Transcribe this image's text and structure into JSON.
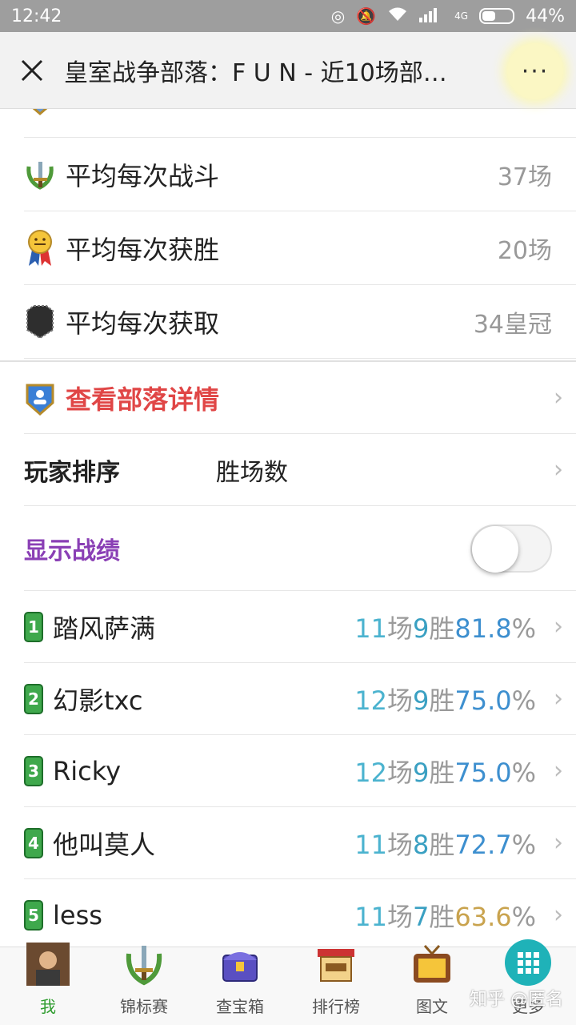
{
  "status_bar": {
    "time": "12:42",
    "battery": "44%",
    "battery_level": 0.44,
    "network": "4G"
  },
  "header": {
    "title": "皇室战争部落：F U N - 近10场部…",
    "more_label": "···"
  },
  "stats": [
    {
      "label": "平均每次战斗",
      "value": "37场",
      "icon": "sword-laurel-icon"
    },
    {
      "label": "平均每次获胜",
      "value": "20场",
      "icon": "medal-icon"
    },
    {
      "label": "平均每次获取",
      "value": "34皇冠",
      "icon": "crown-shield-icon"
    }
  ],
  "clan_link": {
    "label": "查看部落详情"
  },
  "sort": {
    "label": "玩家排序",
    "value": "胜场数"
  },
  "show_record": {
    "label": "显示战绩",
    "enabled": false
  },
  "players": [
    {
      "rank": "1",
      "name": "踏风萨满",
      "games": "11",
      "wins": "9",
      "rate": "81.8",
      "rate_color": "#3d8fcf"
    },
    {
      "rank": "2",
      "name": "幻影txc",
      "games": "12",
      "wins": "9",
      "rate": "75.0",
      "rate_color": "#3d8fcf"
    },
    {
      "rank": "3",
      "name": "Ricky",
      "games": "12",
      "wins": "9",
      "rate": "75.0",
      "rate_color": "#3d8fcf"
    },
    {
      "rank": "4",
      "name": "他叫莫人",
      "games": "11",
      "wins": "8",
      "rate": "72.7",
      "rate_color": "#3d8fcf"
    },
    {
      "rank": "5",
      "name": "less",
      "games": "11",
      "wins": "7",
      "rate": "63.6",
      "rate_color": "#c9a34e"
    }
  ],
  "units": {
    "games": "场",
    "wins": "胜",
    "percent": "%"
  },
  "bottom_nav": [
    {
      "label": "我",
      "icon": "avatar-icon",
      "active": true
    },
    {
      "label": "锦标赛",
      "icon": "sword-laurel-icon",
      "active": false
    },
    {
      "label": "查宝箱",
      "icon": "chest-icon",
      "active": false
    },
    {
      "label": "排行榜",
      "icon": "shop-icon",
      "active": false
    },
    {
      "label": "图文",
      "icon": "tv-icon",
      "active": false
    },
    {
      "label": "更多",
      "icon": "grid-icon",
      "active": false
    }
  ],
  "watermark": "知乎 @匿名",
  "colors": {
    "accent_red": "#e04646",
    "accent_purple": "#8a3fb5",
    "badge_green": "#3fa84c",
    "active_green": "#2e9c2e",
    "more_teal": "#1fb2b8"
  }
}
